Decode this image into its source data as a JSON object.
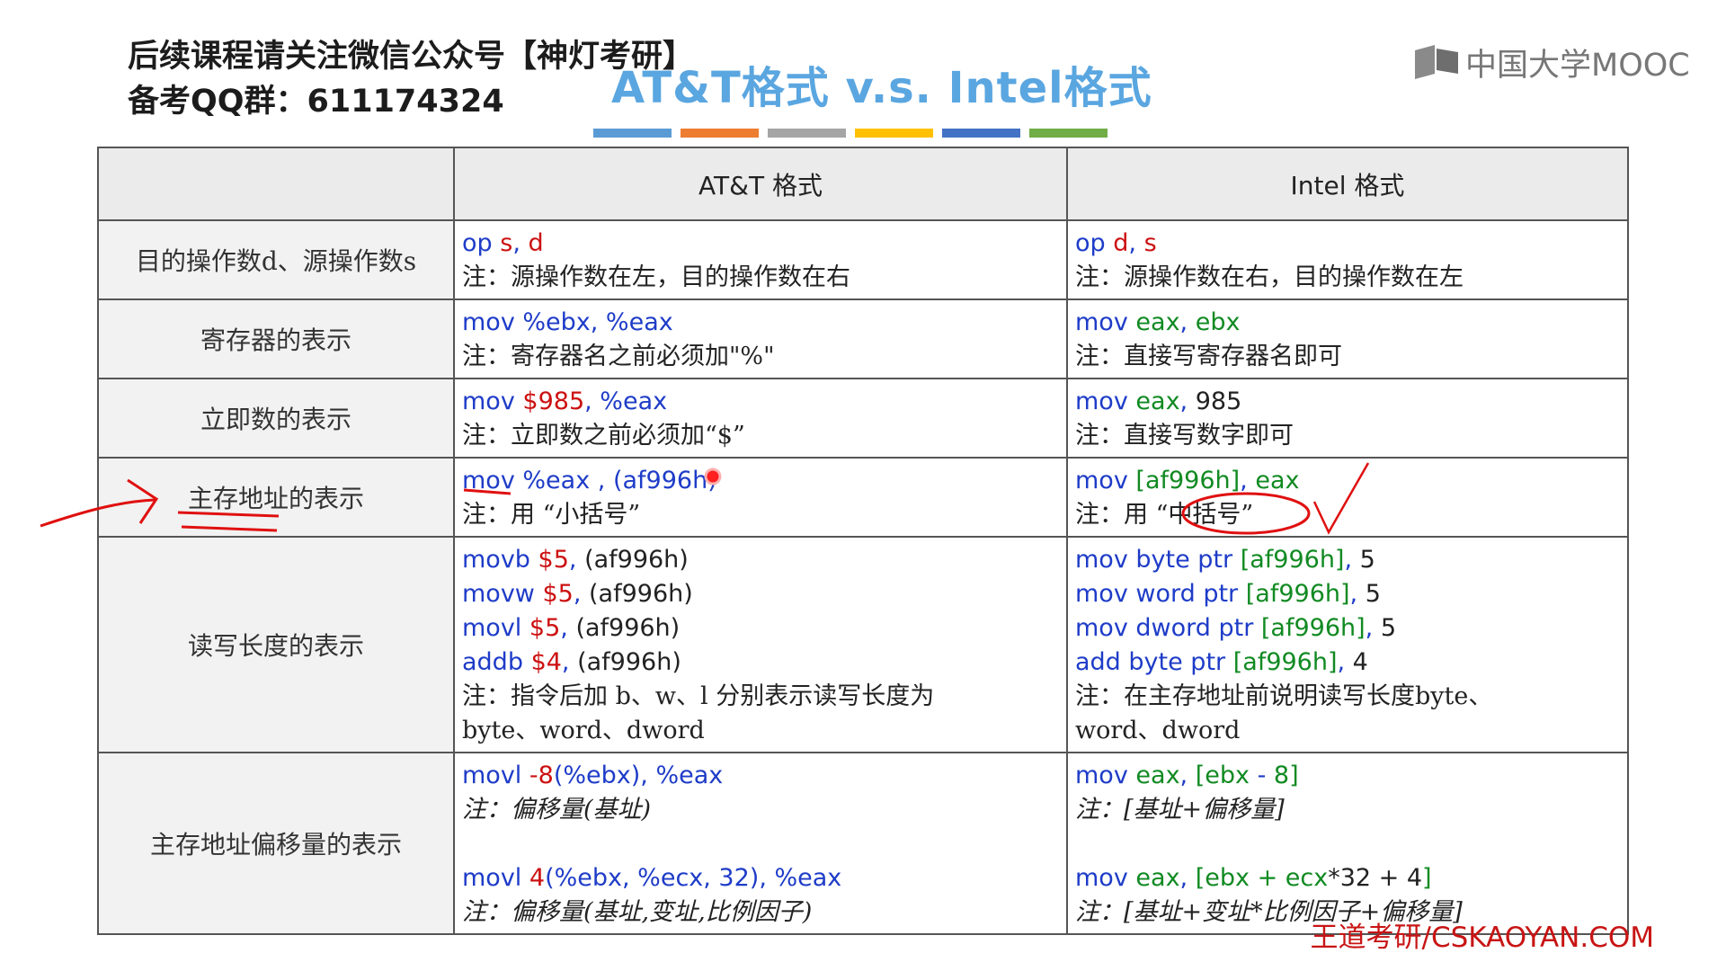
{
  "promo": {
    "line1": "后续课程请关注微信公众号【神灯考研】",
    "line2": "备考QQ群：611174324"
  },
  "title": "AT&T格式 v.s. Intel格式",
  "logo": {
    "text": "中国大学MOOC",
    "icon": "mooc-logo-icon"
  },
  "color_bars": [
    "#5b9bd5",
    "#ed7d31",
    "#a5a5a5",
    "#ffc000",
    "#4472c4",
    "#70ad47"
  ],
  "table": {
    "headers": [
      "",
      "AT&T 格式",
      "Intel 格式"
    ],
    "rows": [
      {
        "label": "目的操作数d、源操作数s",
        "att": {
          "op": "op",
          "s": "s",
          "d": "d",
          "note": "注：源操作数在左，目的操作数在右"
        },
        "intel": {
          "op": "op",
          "d": "d",
          "s": "s",
          "note": "注：源操作数在右，目的操作数在左"
        }
      },
      {
        "label": "寄存器的表示",
        "att": {
          "code": "mov %ebx, %eax",
          "note": "注：寄存器名之前必须加\"%\""
        },
        "intel": {
          "mov": "mov",
          "r1": "eax",
          "r2": "ebx",
          "note": "注：直接写寄存器名即可"
        }
      },
      {
        "label": "立即数的表示",
        "att": {
          "mov": "mov",
          "imm": "$985",
          "reg": "%eax",
          "note": "注：立即数之前必须加“$”"
        },
        "intel": {
          "mov": "mov",
          "reg": "eax",
          "imm": "985",
          "note": "注：直接写数字即可"
        }
      },
      {
        "label": "主存地址的表示",
        "att": {
          "mov": "mov",
          "reg": "%eax",
          "addr": "(af996h)",
          "note": "注：用 “小括号”"
        },
        "intel": {
          "mov": "mov",
          "addr": "[af996h]",
          "reg": "eax",
          "note": "注：用 “中括号”"
        }
      },
      {
        "label": "读写长度的表示",
        "att": {
          "lines": [
            {
              "op": "movb",
              "imm": "$5",
              "addr": "(af996h)"
            },
            {
              "op": "movw",
              "imm": "$5",
              "addr": "(af996h)"
            },
            {
              "op": "movl",
              "imm": "$5",
              "addr": "(af996h)"
            },
            {
              "op": "addb",
              "imm": "$4",
              "addr": "(af996h)"
            }
          ],
          "note1": "注：指令后加 b、w、l 分别表示读写长度为",
          "note2": "byte、word、dword"
        },
        "intel": {
          "lines": [
            {
              "op": "mov byte ptr",
              "addr": "[af996h]",
              "imm": "5"
            },
            {
              "op": "mov word ptr",
              "addr": "[af996h]",
              "imm": "5"
            },
            {
              "op": "mov dword ptr",
              "addr": "[af996h]",
              "imm": "5"
            },
            {
              "op": "add byte ptr",
              "addr": "[af996h]",
              "imm": "4"
            }
          ],
          "note1": "注：在主存地址前说明读写长度byte、",
          "note2": "word、dword"
        }
      },
      {
        "label": "主存地址偏移量的表示",
        "att": {
          "ex1": {
            "op": "movl",
            "off": "-8",
            "base": "(%ebx)",
            "reg": "%eax"
          },
          "note1": "注：偏移量(基址)",
          "ex2": {
            "op": "movl",
            "off": "4",
            "args": "(%ebx, %ecx, 32)",
            "reg": "%eax"
          },
          "note2": "注：偏移量(基址,变址,比例因子)"
        },
        "intel": {
          "ex1": {
            "mov": "mov",
            "reg": "eax",
            "base": "[ebx",
            "minus": " - ",
            "off": "8]"
          },
          "note1": "注：[基址+偏移量]",
          "ex2": {
            "mov": "mov",
            "reg": "eax",
            "open": "[ebx + ecx",
            "scale": "*32 + 4",
            "close": "]"
          },
          "note2": "注：[基址+变址*比例因子+偏移量]"
        }
      }
    ]
  },
  "footer": "王道考研/CSKAOYAN.COM"
}
